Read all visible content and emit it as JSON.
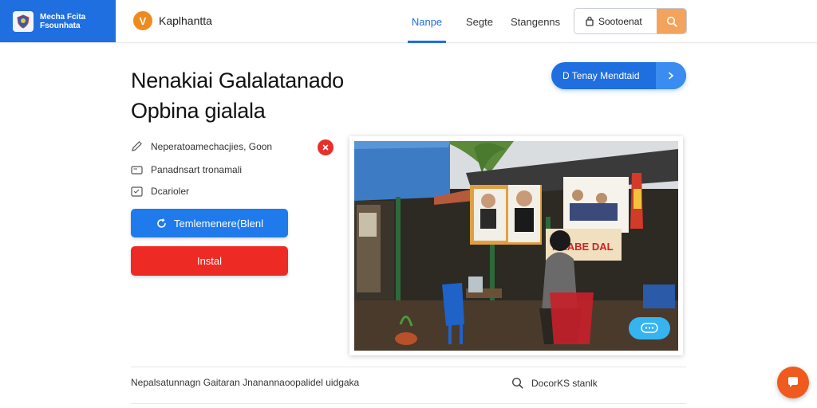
{
  "header": {
    "brand_line1": "Mecha Fcita",
    "brand_line2": "Fsounhata",
    "app_name": "Kaplhantta",
    "app_logo_letter": "V",
    "nav": [
      "Nanpe",
      "Segte",
      "Stangenns"
    ],
    "search_value": "Sootoenat",
    "accent": "#1f6fe0",
    "search_button_color": "#f4a35c"
  },
  "hero": {
    "title_line1": "Nenakiai Galalatanado",
    "title_line2": "Opbina gialala",
    "download_button": "D Tenay Mendtaid"
  },
  "details": [
    {
      "icon": "pencil-icon",
      "text": "Neperatoamechacjies, Goon"
    },
    {
      "icon": "card-icon",
      "text": "Panadnsart tronamali"
    },
    {
      "icon": "calendar-icon",
      "text": "Dcarioler"
    }
  ],
  "actions": {
    "primary_label": "Temlemenere(Blenl",
    "install_label": "Instal",
    "primary_color": "#1f7bec",
    "install_color": "#ee2a24"
  },
  "photo": {
    "poster_sign": "NAABE DAL"
  },
  "footer": {
    "text": "Nepalsatunnagn Gaitaran Jnanannaoopalidel uidgaka",
    "search_label": "DocorKS stanlk"
  }
}
